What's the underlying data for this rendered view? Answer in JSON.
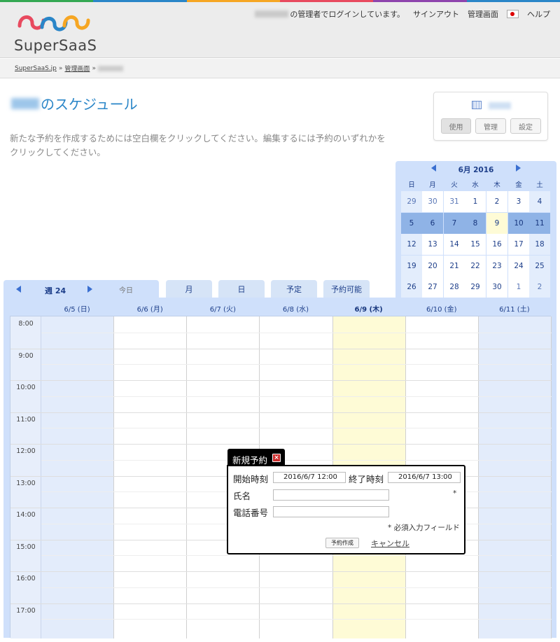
{
  "brand": {
    "name": "SuperSaaS",
    "colors": [
      "#e84a5f",
      "#2a86c8",
      "#f6a623",
      "#34a853"
    ]
  },
  "topnav": {
    "login_text": "の管理者でログインしています。",
    "signout": "サインアウト",
    "admin": "管理画面",
    "help": "ヘルプ",
    "flag_icon": "japan-flag-icon"
  },
  "breadcrumb": {
    "root": "SuperSaaS.jp",
    "sep": "»",
    "admin": "管理画面"
  },
  "page": {
    "title_suffix": "のスケジュール",
    "instructions": "新たな予約を作成するためには空白欄をクリックしてください。編集するには予約のいずれかをクリックしてください。"
  },
  "side_panel": {
    "icon": "calendar-icon",
    "buttons": [
      "使用",
      "管理",
      "設定"
    ],
    "active": "使用"
  },
  "mini_calendar": {
    "month_label": "6月 2016",
    "dow": [
      "日",
      "月",
      "火",
      "水",
      "木",
      "金",
      "土"
    ],
    "weeks": [
      [
        "29",
        "30",
        "31",
        "1",
        "2",
        "3",
        "4"
      ],
      [
        "5",
        "6",
        "7",
        "8",
        "9",
        "10",
        "11"
      ],
      [
        "12",
        "13",
        "14",
        "15",
        "16",
        "17",
        "18"
      ],
      [
        "19",
        "20",
        "21",
        "22",
        "23",
        "24",
        "25"
      ],
      [
        "26",
        "27",
        "28",
        "29",
        "30",
        "1",
        "2"
      ]
    ]
  },
  "week_nav": {
    "week_label": "週 24",
    "today": "今日",
    "tabs": [
      "月",
      "日",
      "予定",
      "予約可能"
    ]
  },
  "grid": {
    "days": [
      "6/5 (日)",
      "6/6 (月)",
      "6/7 (火)",
      "6/8 (水)",
      "6/9 (木)",
      "6/10 (金)",
      "6/11 (土)"
    ],
    "times": [
      "8:00",
      "9:00",
      "10:00",
      "11:00",
      "12:00",
      "13:00",
      "14:00",
      "15:00",
      "16:00",
      "17:00"
    ]
  },
  "popup": {
    "title": "新規予約",
    "start_label": "開始時刻",
    "start_value": "2016/6/7  12:00",
    "end_label": "終了時刻",
    "end_value": "2016/6/7  13:00",
    "name_label": "氏名",
    "phone_label": "電話番号",
    "required_mark": "*",
    "required_note": "* 必須入力フィールド",
    "create_button": "予約作成",
    "cancel_link": "キャンセル"
  }
}
